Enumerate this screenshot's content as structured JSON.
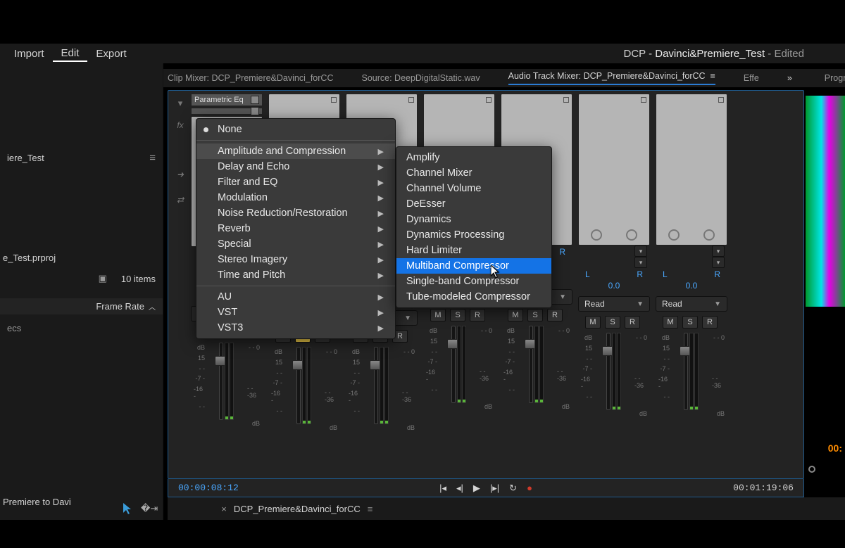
{
  "topbar": {
    "menus": [
      "Import",
      "Edit",
      "Export"
    ],
    "active_menu_index": 1,
    "project_prefix": "DCP - ",
    "project_name": "Davinci&Premiere_Test",
    "project_suffix": " - Edited"
  },
  "tabs": {
    "clip_mixer": "Clip Mixer: DCP_Premiere&Davinci_forCC",
    "source": "Source: DeepDigitalStatic.wav",
    "audio_mixer": "Audio Track Mixer: DCP_Premiere&Davinci_forCC",
    "effects_truncated": "Effe",
    "program_truncated": "Progr"
  },
  "left_panel": {
    "project_label": "iere_Test",
    "project_file": "e_Test.prproj",
    "items_count": "10 items",
    "frame_rate_label": "Frame Rate",
    "ecs": "ecs",
    "bottom_label": "Premiere to Davi"
  },
  "mixer": {
    "fx_label": "Parametric Eq",
    "read_label": "Read",
    "pan_left": "L",
    "pan_right": "R",
    "pan_value": "0.0",
    "msr": {
      "m": "M",
      "s": "S",
      "r": "R"
    },
    "scale_left": [
      "dB",
      "15",
      "- -",
      "-7 -",
      "-16 -",
      "- -"
    ],
    "scale_right": [
      "- - 0",
      "",
      "",
      "- - -36",
      ""
    ],
    "db_label": "dB",
    "tracks": [
      {
        "solo": false
      },
      {
        "solo": true
      },
      {
        "solo": false
      },
      {
        "solo": false
      },
      {
        "solo": false
      },
      {
        "solo": false
      },
      {
        "solo": false
      }
    ]
  },
  "send_chev_value": "▾",
  "transport": {
    "tc_in": "00:00:08:12",
    "tc_out": "00:01:19:06"
  },
  "sequence": {
    "name": "DCP_Premiere&Davinci_forCC"
  },
  "right": {
    "tc_orange": "00:"
  },
  "context_menu": {
    "none": "None",
    "categories": [
      "Amplitude and Compression",
      "Delay and Echo",
      "Filter and EQ",
      "Modulation",
      "Noise Reduction/Restoration",
      "Reverb",
      "Special",
      "Stereo Imagery",
      "Time and Pitch"
    ],
    "open_category_index": 0,
    "plugin_formats": [
      "AU",
      "VST",
      "VST3"
    ],
    "submenu": [
      "Amplify",
      "Channel Mixer",
      "Channel Volume",
      "DeEsser",
      "Dynamics",
      "Dynamics Processing",
      "Hard Limiter",
      "Multiband Compressor",
      "Single-band Compressor",
      "Tube-modeled Compressor"
    ],
    "selected_submenu_index": 7
  }
}
